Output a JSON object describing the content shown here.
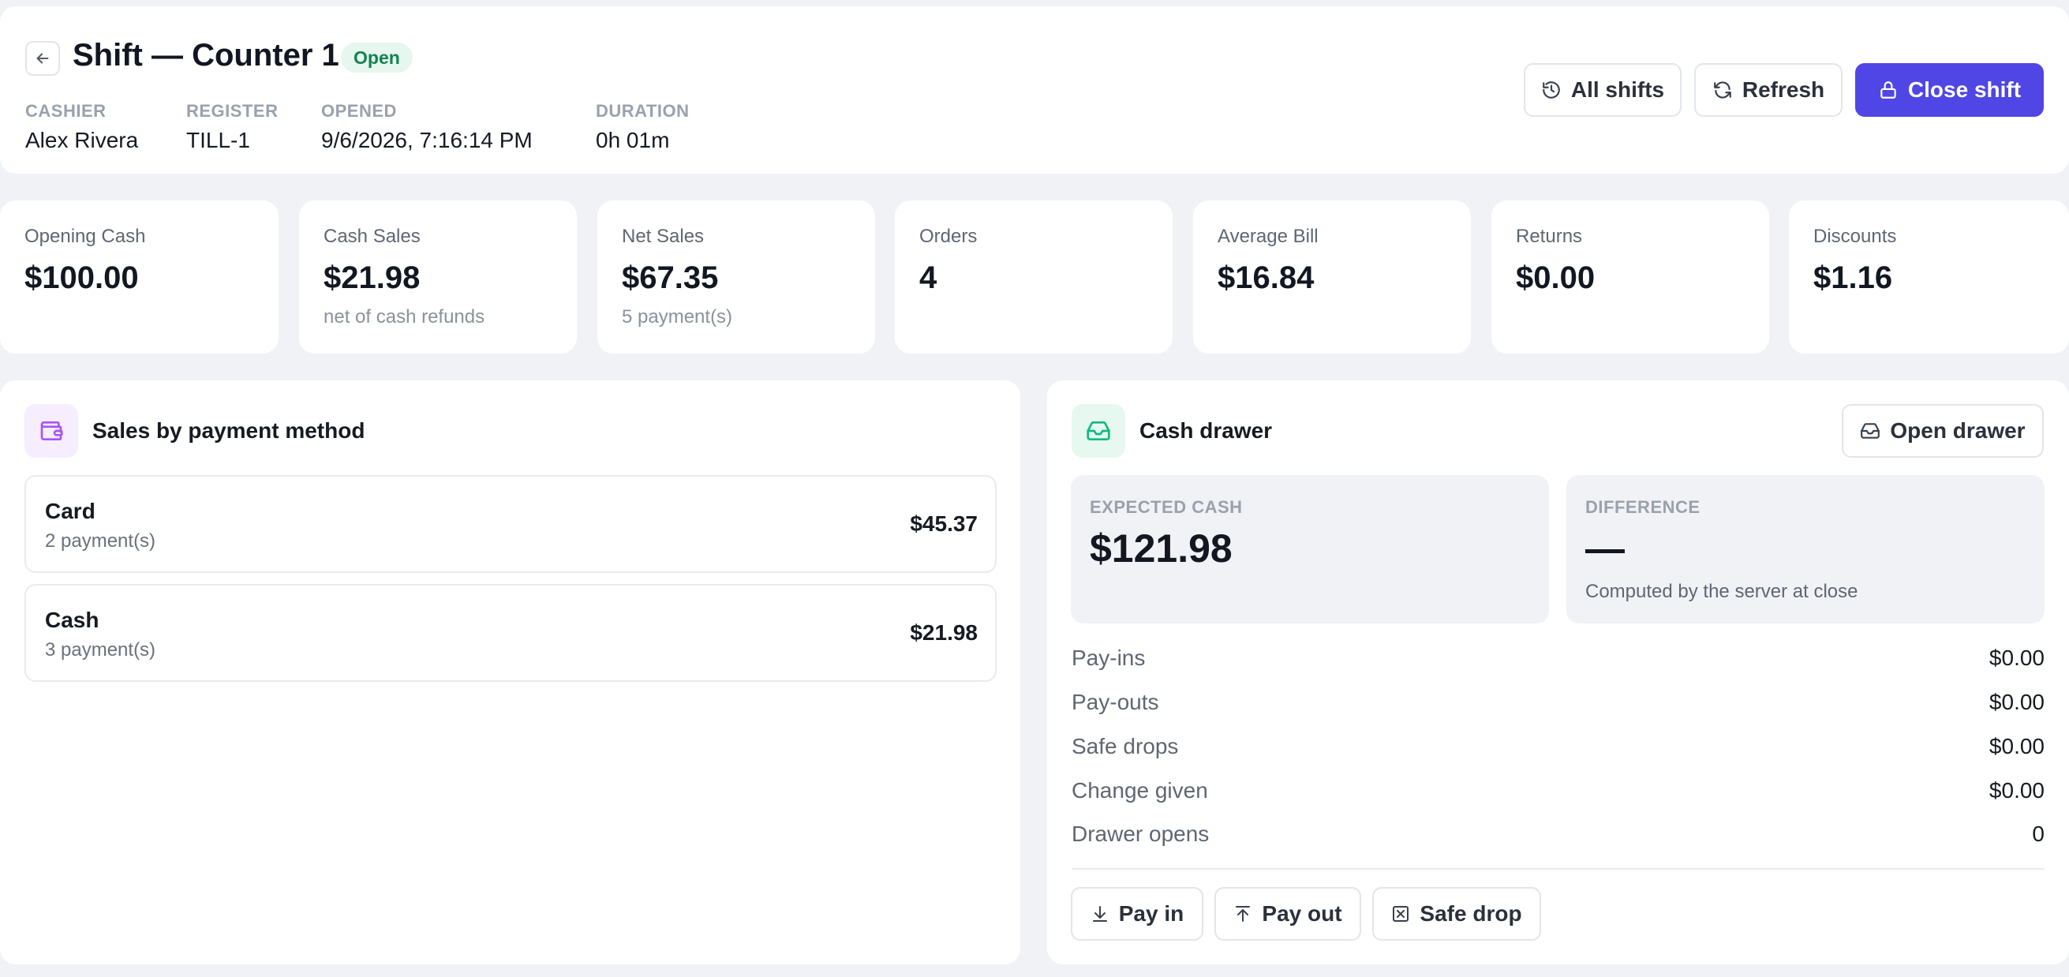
{
  "header": {
    "title": "Shift — Counter 1",
    "status": "Open",
    "meta": [
      {
        "label": "CASHIER",
        "value": "Alex Rivera"
      },
      {
        "label": "REGISTER",
        "value": "TILL-1"
      },
      {
        "label": "OPENED",
        "value": "9/6/2026, 7:16:14 PM"
      },
      {
        "label": "DURATION",
        "value": "0h 01m"
      }
    ],
    "buttons": {
      "all_shifts": "All shifts",
      "refresh": "Refresh",
      "close_shift": "Close shift"
    }
  },
  "stats": [
    {
      "label": "Opening Cash",
      "value": "$100.00",
      "sub": ""
    },
    {
      "label": "Cash Sales",
      "value": "$21.98",
      "sub": "net of cash refunds"
    },
    {
      "label": "Net Sales",
      "value": "$67.35",
      "sub": "5 payment(s)"
    },
    {
      "label": "Orders",
      "value": "4",
      "sub": ""
    },
    {
      "label": "Average Bill",
      "value": "$16.84",
      "sub": ""
    },
    {
      "label": "Returns",
      "value": "$0.00",
      "sub": ""
    },
    {
      "label": "Discounts",
      "value": "$1.16",
      "sub": ""
    }
  ],
  "payments": {
    "title": "Sales by payment method",
    "methods": [
      {
        "name": "Card",
        "count": "2 payment(s)",
        "amount": "$45.37"
      },
      {
        "name": "Cash",
        "count": "3 payment(s)",
        "amount": "$21.98"
      }
    ]
  },
  "drawer": {
    "title": "Cash drawer",
    "open_drawer": "Open drawer",
    "expected_label": "EXPECTED CASH",
    "expected_value": "$121.98",
    "difference_label": "DIFFERENCE",
    "difference_value": "—",
    "difference_note": "Computed by the server at close",
    "lines": [
      {
        "label": "Pay-ins",
        "value": "$0.00"
      },
      {
        "label": "Pay-outs",
        "value": "$0.00"
      },
      {
        "label": "Safe drops",
        "value": "$0.00"
      },
      {
        "label": "Change given",
        "value": "$0.00"
      },
      {
        "label": "Drawer opens",
        "value": "0"
      }
    ],
    "actions": {
      "pay_in": "Pay in",
      "pay_out": "Pay out",
      "safe_drop": "Safe drop"
    }
  },
  "colors": {
    "primary": "#4f46e5",
    "status_bg": "#e5f7ee",
    "status_text": "#13834f",
    "wallet_icon": "#a855f7",
    "drawer_icon": "#10b981"
  },
  "icons": {
    "back": "arrow-left-icon",
    "all_shifts": "history-icon",
    "refresh": "refresh-icon",
    "close_shift": "lock-icon",
    "payments": "wallet-icon",
    "drawer": "inbox-icon",
    "open_drawer": "inbox-icon",
    "pay_in": "download-icon",
    "pay_out": "upload-icon",
    "safe_drop": "x-box-icon"
  }
}
